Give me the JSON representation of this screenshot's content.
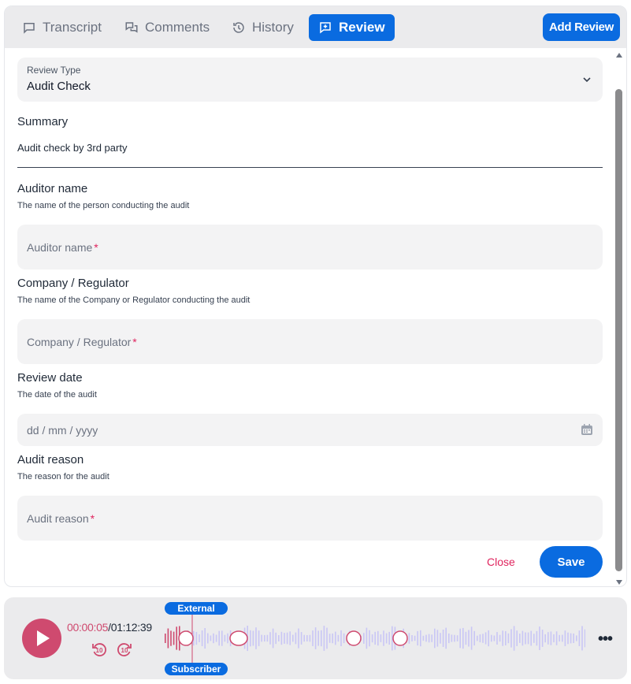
{
  "tabs": [
    {
      "label": "Transcript",
      "icon": "chat-bubble-icon",
      "active": false
    },
    {
      "label": "Comments",
      "icon": "comments-icon",
      "active": false
    },
    {
      "label": "History",
      "icon": "history-icon",
      "active": false
    },
    {
      "label": "Review",
      "icon": "add-review-icon",
      "active": true
    }
  ],
  "header": {
    "add_review_label": "Add Review"
  },
  "form": {
    "review_type": {
      "label": "Review Type",
      "value": "Audit Check"
    },
    "summary": {
      "title": "Summary",
      "value": "Audit check by 3rd party"
    },
    "auditor": {
      "title": "Auditor name",
      "help": "The name of the person conducting the audit",
      "placeholder": "Auditor name",
      "required": "*"
    },
    "company": {
      "title": "Company / Regulator",
      "help": "The name of the Company or Regulator conducting the audit",
      "placeholder": "Company / Regulator",
      "required": "*"
    },
    "date": {
      "title": "Review date",
      "help": "The date of the audit",
      "placeholder": "dd / mm / yyyy"
    },
    "reason": {
      "title": "Audit reason",
      "help": "The reason for the audit",
      "placeholder": "Audit reason",
      "required": "*"
    },
    "close_label": "Close",
    "save_label": "Save"
  },
  "player": {
    "current_time": "00:00:05",
    "separator": "/",
    "total_time": "01:12:39",
    "skip_back": "10",
    "skip_forward": "10",
    "track_top_label": "External",
    "track_bottom_label": "Subscriber",
    "more_label": "•••"
  },
  "colors": {
    "accent": "#0a6be0",
    "played": "#cf4a6f",
    "unplayed": "#c9c6f5",
    "required": "#e0245e"
  }
}
